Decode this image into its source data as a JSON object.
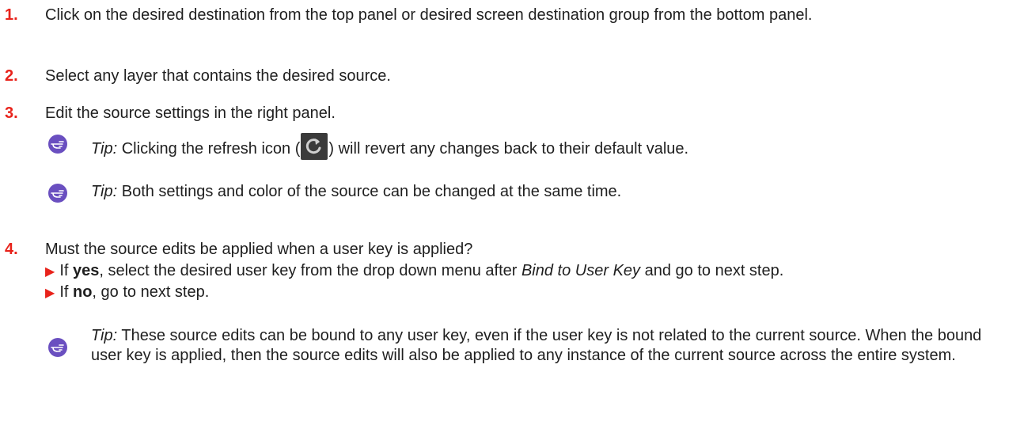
{
  "steps": [
    {
      "number": "1.",
      "text": "Click on the desired destination from the top panel or desired screen destination group from the bottom panel."
    },
    {
      "number": "2.",
      "text": "Select any layer that contains the desired source."
    },
    {
      "number": "3.",
      "text": "Edit the source settings in the right panel."
    },
    {
      "number": "4.",
      "text": "Must the source edits be applied when a user key is applied?"
    }
  ],
  "tips": {
    "label": "Tip:",
    "tip1_before": "Clicking the refresh icon (",
    "tip1_after": ") will revert any changes back to their default value.",
    "tip2": "Both settings and color of the source can be changed at the same time.",
    "tip3": "These source edits can be bound to any user key, even if the user key is not related to the current source. When the bound user key is applied, then the source edits will also be applied to any instance of the current source across the entire system."
  },
  "options": {
    "yes_prefix": "If ",
    "yes_word": "yes",
    "yes_mid": ", select the desired user key from the drop down menu after ",
    "yes_italic": "Bind to User Key",
    "yes_suffix": " and go to next step.",
    "no_prefix": "If ",
    "no_word": "no",
    "no_suffix": ", go to next step."
  },
  "icons": {
    "tip": "pointing-hand-icon",
    "refresh": "refresh-icon",
    "bullet": "red-triangle-bullet-icon"
  },
  "colors": {
    "step_number": "#e8231b",
    "tip_icon": "#6a4fc0",
    "refresh_icon_bg": "#3a3a3a"
  }
}
